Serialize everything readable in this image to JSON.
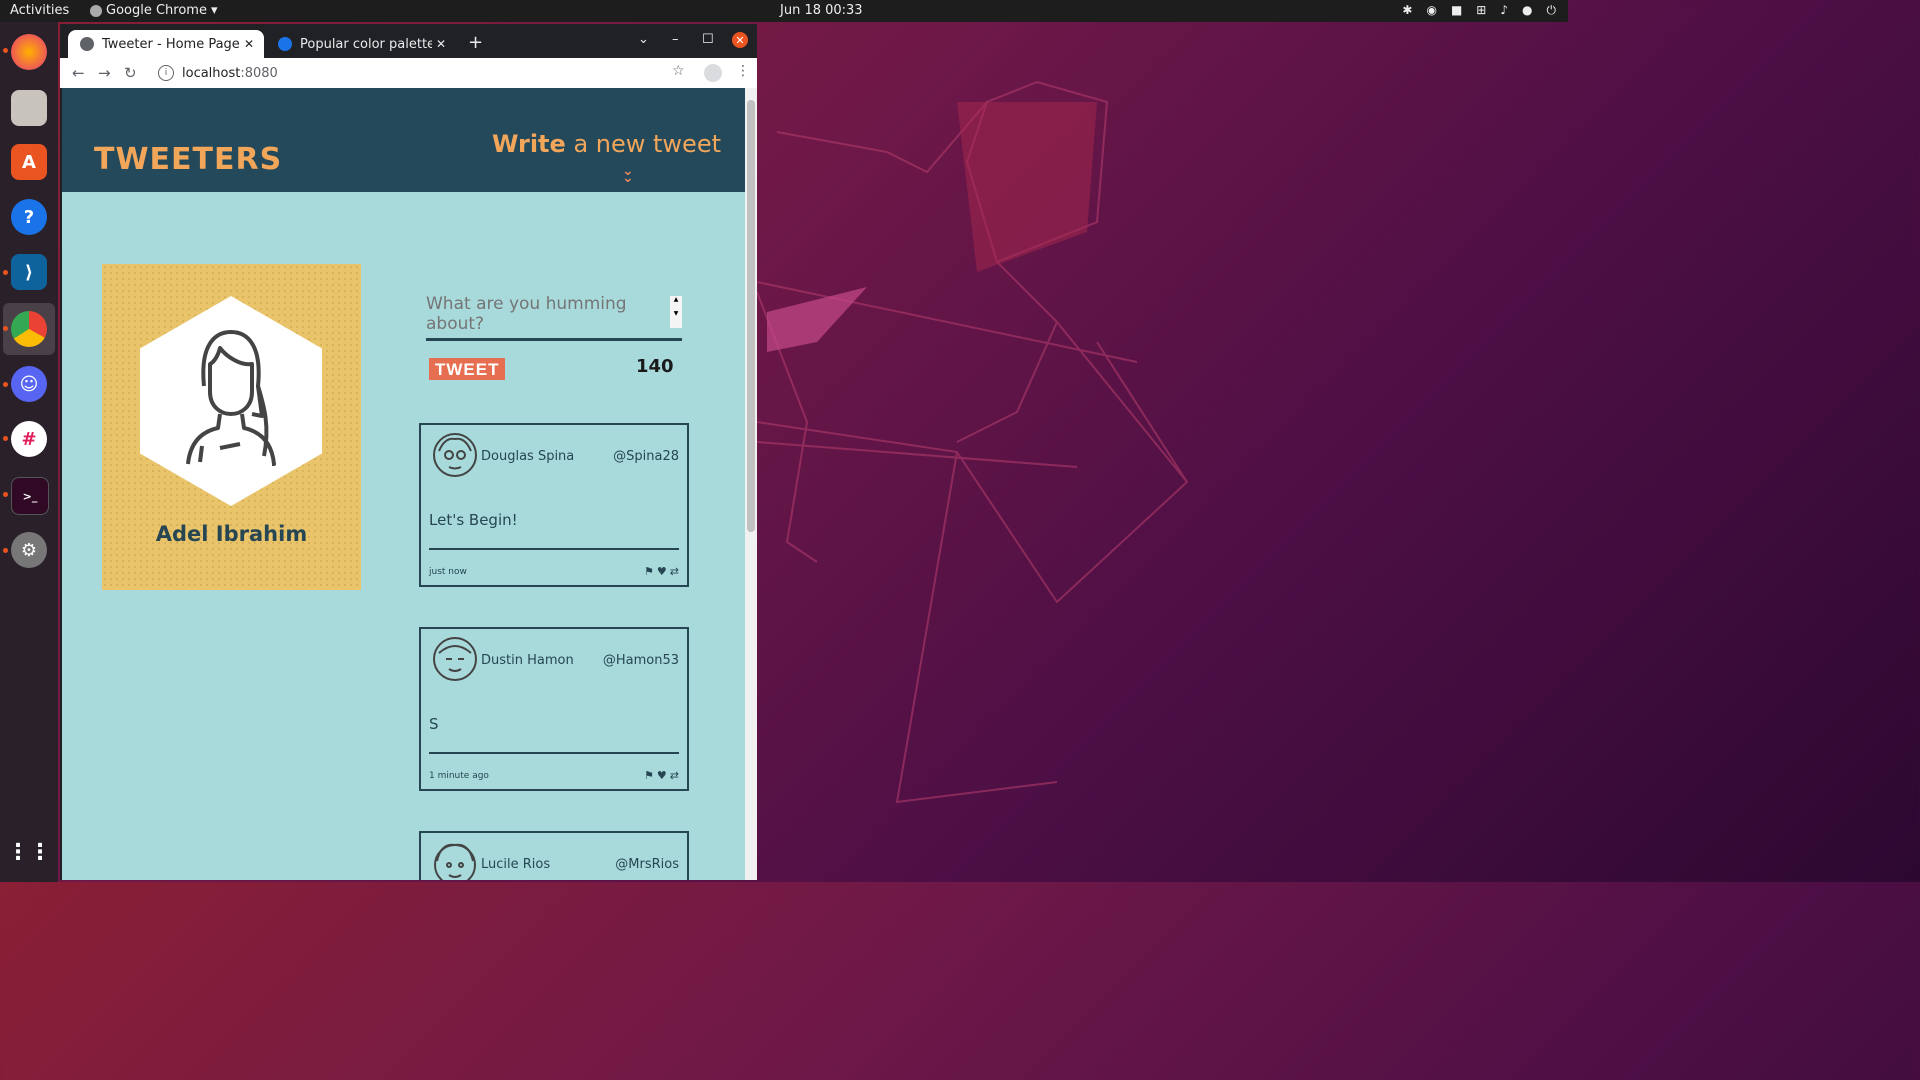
{
  "topbar": {
    "activities": "Activities",
    "app_name": "Google Chrome",
    "clock": "Jun 18  00:33"
  },
  "dock": {
    "items": [
      "firefox-icon",
      "files-icon",
      "software-icon",
      "help-icon",
      "vscode-icon",
      "chrome-icon",
      "discord-icon",
      "slack-icon",
      "terminal-icon",
      "settings-icon",
      "app-grid-icon"
    ]
  },
  "browser": {
    "tabs": [
      {
        "label": "Tweeter - Home Page",
        "active": true
      },
      {
        "label": "Popular color palettes - C",
        "active": false
      }
    ],
    "url_host": "localhost",
    "url_port": ":8080"
  },
  "site": {
    "brand": "TWEETERS",
    "compose_bold": "Write",
    "compose_rest": " a new tweet",
    "profile_name": "Adel Ibrahim",
    "composer_placeholder": "What are you humming about?",
    "tweet_button": "TWEET",
    "counter": "140"
  },
  "tweets": [
    {
      "name": "Douglas Spina",
      "handle": "@Spina28",
      "text": "Let's Begin!",
      "time": "just now"
    },
    {
      "name": "Dustin Hamon",
      "handle": "@Hamon53",
      "text": "S",
      "time": "1 minute ago"
    },
    {
      "name": "Lucile Rios",
      "handle": "@MrsRios",
      "text": "",
      "time": ""
    }
  ],
  "colors": {
    "header_bg": "#24495b",
    "page_bg": "#a8dadc",
    "accent": "#f2a65a",
    "button": "#e76f51",
    "card": "#e9c46a"
  }
}
